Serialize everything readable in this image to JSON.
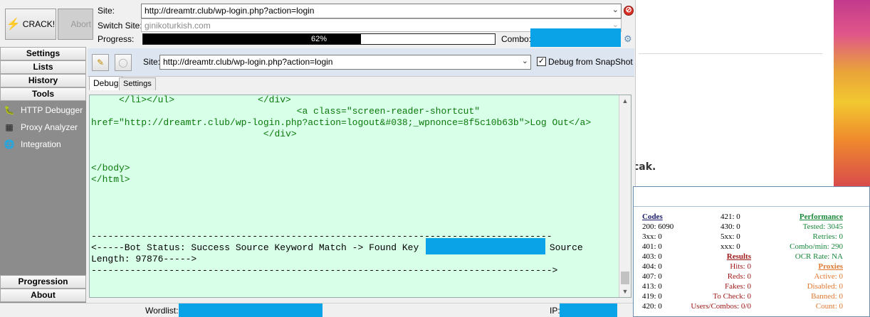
{
  "toolbar": {
    "crack_label": "CRACK!",
    "abort_label": "Abort",
    "site_label": "Site:",
    "site_value": "http://dreamtr.club/wp-login.php?action=login",
    "switch_site_label": "Switch Site:",
    "switch_site_value": "ginikoturkish.com",
    "progress_label": "Progress:",
    "progress_percent": 62,
    "progress_text": "62%",
    "combo_label": "Combo:"
  },
  "nav": {
    "top_sections": [
      "Settings",
      "Lists",
      "History",
      "Tools"
    ],
    "tools": [
      {
        "label": "HTTP Debugger",
        "icon": "debugger-icon"
      },
      {
        "label": "Proxy Analyzer",
        "icon": "proxy-analyzer-icon"
      },
      {
        "label": "Integration",
        "icon": "globe-icon"
      }
    ],
    "bottom_sections": [
      "Progression",
      "About"
    ]
  },
  "debug": {
    "site_label": "Site:",
    "site_value": "http://dreamtr.club/wp-login.php?action=login",
    "snapshot_label": "Debug from SnapShot",
    "snapshot_checked": true,
    "tabs": [
      "Debug",
      "Settings"
    ],
    "lines": [
      "     </li></ul>               </div>",
      "                                     <a class=\"screen-reader-shortcut\"",
      "href=\"http://dreamtr.club/wp-login.php?action=logout&#038;_wpnonce=8f5c10b63b\">Log Out</a>",
      "                               </div>",
      "",
      "",
      "</body>",
      "</html>",
      "",
      "",
      "",
      "",
      "-----------------------------------------------------------------------------------"
    ],
    "status_line_1a": "<-----Bot Status: Success Source Keyword Match -> Found Key",
    "status_line_1b": "- Source",
    "status_line_2": "Length: 97876----->",
    "status_line_3": "----------------------------------------------------------------------------------->"
  },
  "statusbar": {
    "wordlist_label": "Wordlist:",
    "ip_label": "IP:"
  },
  "background_page": {
    "bold_fragment": "cak."
  },
  "stats": {
    "codes_header": "Codes",
    "codes": [
      "200: 6090",
      "3xx: 0",
      "401: 0",
      "403: 0",
      "404: 0",
      "407: 0",
      "413: 0",
      "419: 0",
      "420: 0"
    ],
    "codes2": [
      "421: 0",
      "430: 0",
      "5xx: 0",
      "xxx: 0"
    ],
    "results_header": "Results",
    "results": [
      "Hits: 0",
      "Reds: 0",
      "Fakes: 0",
      "To Check: 0",
      "Users/Combos: 0/0"
    ],
    "performance_header": "Performance",
    "performance": [
      "Tested: 3045",
      "Retries: 0",
      "Combo/min: 290",
      "OCR Rate: NA"
    ],
    "proxies_header": "Proxies",
    "proxies": [
      "Active: 0",
      "Disabled: 0",
      "Banned: 0",
      "Count: 0"
    ]
  }
}
